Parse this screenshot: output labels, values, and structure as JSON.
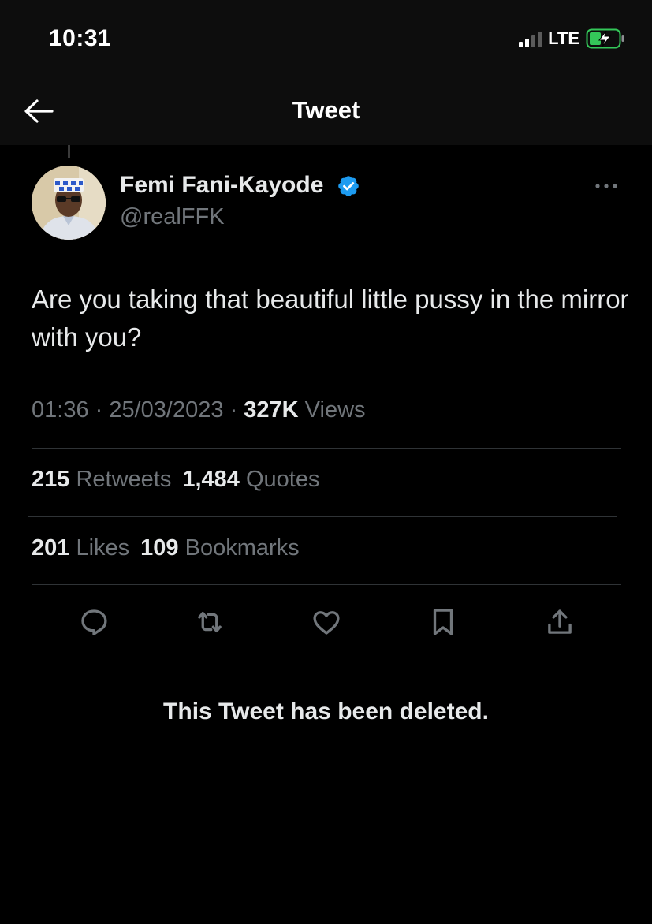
{
  "status_bar": {
    "time": "10:31",
    "network": "LTE",
    "battery_state": "charging",
    "battery_color": "#34c759"
  },
  "header": {
    "title": "Tweet",
    "back_icon": "arrow-left-icon"
  },
  "tweet": {
    "author": {
      "name": "Femi Fani-Kayode",
      "handle": "@realFFK",
      "verified": true,
      "verified_color": "#1d9bf0"
    },
    "text": "Are you taking that beautiful little pussy in the mirror with you?",
    "meta": {
      "time": "01:36",
      "sep1": " · ",
      "date": "25/03/2023",
      "sep2": " · ",
      "views_count": "327K",
      "views_label": " Views"
    },
    "stats": {
      "retweets_count": "215",
      "retweets_label": " Retweets",
      "quotes_count": "1,484",
      "quotes_label": " Quotes",
      "likes_count": "201",
      "likes_label": " Likes",
      "bookmarks_count": "109",
      "bookmarks_label": " Bookmarks"
    },
    "actions": [
      {
        "name": "reply",
        "icon": "reply-icon"
      },
      {
        "name": "retweet",
        "icon": "retweet-icon"
      },
      {
        "name": "like",
        "icon": "heart-icon"
      },
      {
        "name": "bookmark",
        "icon": "bookmark-icon"
      },
      {
        "name": "share",
        "icon": "share-icon"
      }
    ]
  },
  "reply": {
    "deleted_notice": "This Tweet has been deleted."
  }
}
